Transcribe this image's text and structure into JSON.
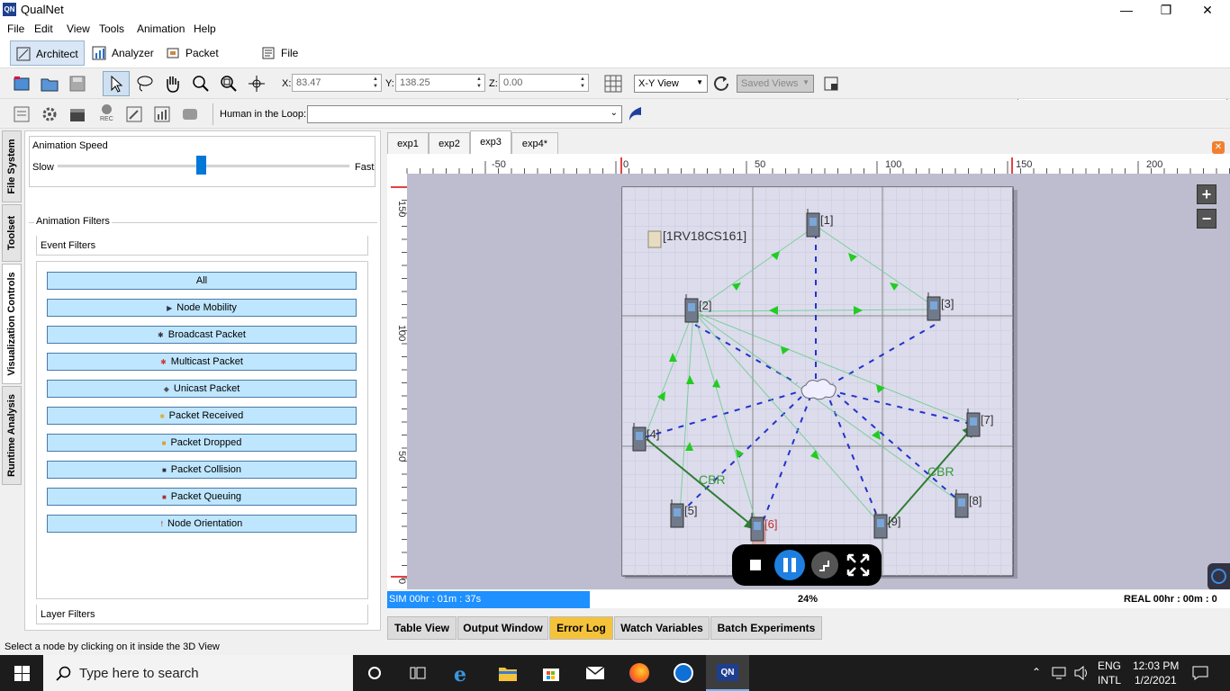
{
  "window": {
    "title": "QualNet",
    "logo": "QN"
  },
  "menu": [
    "File",
    "Edit",
    "View",
    "Tools",
    "Animation",
    "Help"
  ],
  "perspectives": [
    "Architect",
    "Analyzer",
    "Packet Tracer",
    "File Editor"
  ],
  "toolbar": {
    "x_label": "X:",
    "x_value": "83.47",
    "y_label": "Y:",
    "y_value": "138.25",
    "z_label": "Z:",
    "z_value": "0.00",
    "view_mode": "X-Y View",
    "saved_views": "Saved Views",
    "hitl_label": "Human in the Loop:",
    "rec_label": "REC"
  },
  "side_tabs": [
    "File System",
    "Toolset",
    "Visualization Controls",
    "Runtime Analysis"
  ],
  "animation_speed": {
    "title": "Animation Speed",
    "slow": "Slow",
    "fast": "Fast",
    "level": 0.49
  },
  "animation_filters": {
    "title": "Animation Filters",
    "event_filters": "Event Filters",
    "layer_filters": "Layer Filters",
    "buttons": [
      {
        "label": "All",
        "icon": ""
      },
      {
        "label": "Node Mobility",
        "icon": "node-mobility-icon"
      },
      {
        "label": "Broadcast Packet",
        "icon": "broadcast-icon"
      },
      {
        "label": "Multicast Packet",
        "icon": "multicast-icon"
      },
      {
        "label": "Unicast Packet",
        "icon": "unicast-icon"
      },
      {
        "label": "Packet Received",
        "icon": "packet-received-icon"
      },
      {
        "label": "Packet Dropped",
        "icon": "packet-dropped-icon"
      },
      {
        "label": "Packet Collision",
        "icon": "packet-collision-icon"
      },
      {
        "label": "Packet Queuing",
        "icon": "packet-queuing-icon"
      },
      {
        "label": "Node Orientation",
        "icon": "node-orientation-icon"
      }
    ]
  },
  "experiment_tabs": [
    "exp1",
    "exp2",
    "exp3",
    "exp4*"
  ],
  "canvas": {
    "ruler_x_labels": [
      "-50",
      "0",
      "50",
      "100",
      "150",
      "200"
    ],
    "ruler_y_labels": [
      "150",
      "100",
      "50",
      "0"
    ],
    "scenario_label": "[1RV18CS161]",
    "nodes": [
      "[1]",
      "[2]",
      "[3]",
      "[4]",
      "[5]",
      "[6]",
      "[7]",
      "[8]",
      "[9]"
    ],
    "app_labels": [
      "CBR",
      "CBR"
    ],
    "zoom_in": "+",
    "zoom_out": "−"
  },
  "progress": {
    "sim_time": "SIM 00hr : 01m : 37s",
    "percent_text": "24%",
    "fraction": 0.24,
    "real_time": "REAL 00hr : 00m : 0"
  },
  "bottom_tabs": [
    "Table View",
    "Output Window",
    "Error Log",
    "Watch Variables",
    "Batch Experiments"
  ],
  "status": "Select a node by clicking on it inside the 3D View",
  "taskbar": {
    "search_placeholder": "Type here to search",
    "lang1": "ENG",
    "lang2": "INTL",
    "time": "12:03 PM",
    "date": "1/2/2021"
  },
  "colors": {
    "accent": "#0078d7",
    "filter_button": "#bfe6ff",
    "error_tab": "#f5c33b",
    "arrow": "#22cc22",
    "dash": "#2233cc"
  }
}
